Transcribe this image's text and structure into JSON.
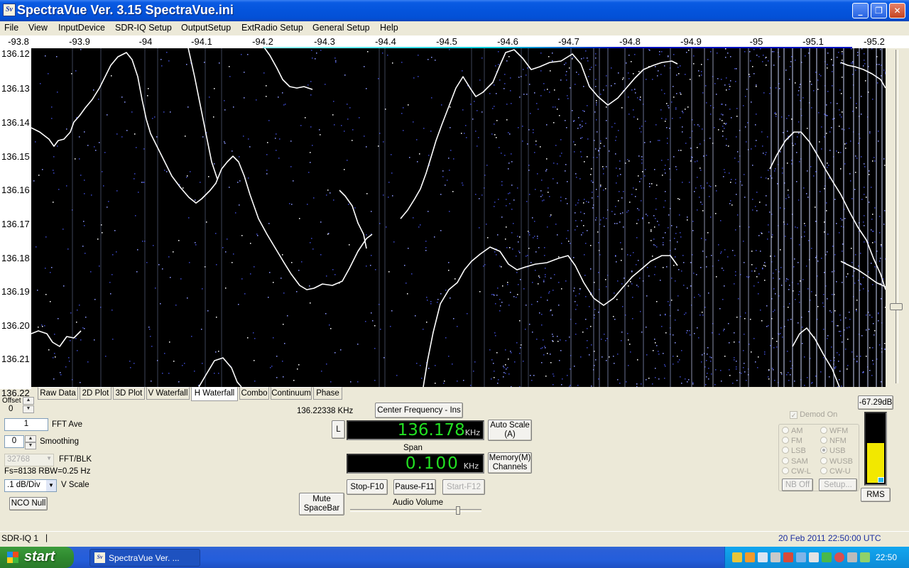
{
  "window": {
    "icon": "Sv",
    "title": "SpectraVue Ver. 3.15  SpectraVue.ini",
    "minimize": "minimize-icon",
    "maximize": "maximize-icon",
    "close": "close-icon"
  },
  "menu": [
    "File",
    "View",
    "InputDevice",
    "SDR-IQ Setup",
    "OutputSetup",
    "ExtRadio Setup",
    "General Setup",
    "Help"
  ],
  "freq_axis": [
    "-93.8",
    "-93.9",
    "-94",
    "-94.1",
    "-94.2",
    "-94.3",
    "-94.4",
    "-94.5",
    "-94.6",
    "-94.7",
    "-94.8",
    "-94.9",
    "-95",
    "-95.1",
    "-95.2"
  ],
  "time_axis": [
    "136.12",
    "136.13",
    "136.14",
    "136.15",
    "136.16",
    "136.17",
    "136.18",
    "136.19",
    "136.20",
    "136.21",
    "136.22"
  ],
  "tabs": [
    "Raw Data",
    "2D Plot",
    "3D Plot",
    "V Waterfall",
    "H Waterfall",
    "Combo",
    "Continuum",
    "Phase"
  ],
  "active_tab": "H Waterfall",
  "controls": {
    "offset_label": "Offset",
    "offset_value": "0",
    "fft_ave_value": "1",
    "fft_ave_label": "FFT Ave",
    "smoothing_value": "0",
    "smoothing_label": "Smoothing",
    "fft_blk_value": "32768",
    "fft_blk_label": "FFT/BLK",
    "fs_info": "Fs=8138 RBW=0.25 Hz",
    "vscale_value": ".1 dB/Div",
    "vscale_label": "V Scale",
    "nco_null": "NCO Null",
    "cursor_freq": "136.22338 KHz",
    "center_freq_btn": "Center Frequency - Ins",
    "l_btn": "L",
    "center_freq_value": "136.178",
    "center_freq_unit": "KHz",
    "auto_scale": "Auto Scale\n(A)",
    "span_label": "Span",
    "span_value": "0.100",
    "span_unit": "KHz",
    "memory_channels": "Memory(M)\nChannels",
    "mute": "Mute\nSpaceBar",
    "stop": "Stop-F10",
    "pause": "Pause-F11",
    "start": "Start-F12",
    "audio_volume": "Audio Volume",
    "audio_volume_level": 0.82,
    "level_db": "-67.29dB",
    "demod_on": "Demod On",
    "demod_modes": [
      "AM",
      "WFM",
      "FM",
      "NFM",
      "LSB",
      "USB",
      "SAM",
      "WUSB",
      "CW-L",
      "CW-U"
    ],
    "demod_selected": "USB",
    "nb_off": "NB Off",
    "setup": "Setup...",
    "rms": "RMS",
    "meter_level": 0.56
  },
  "status": {
    "left": "SDR-IQ 1",
    "right": "20 Feb 2011   22:50:00 UTC"
  },
  "taskbar": {
    "start": "start",
    "app_button": "SpectraVue Ver. ...",
    "clock": "22:50"
  },
  "colors": {
    "lcd_text": "#22e022",
    "title_bar": "#0454dc",
    "waterfall_bg": "#000000",
    "start_green": "#3c9c3c"
  }
}
